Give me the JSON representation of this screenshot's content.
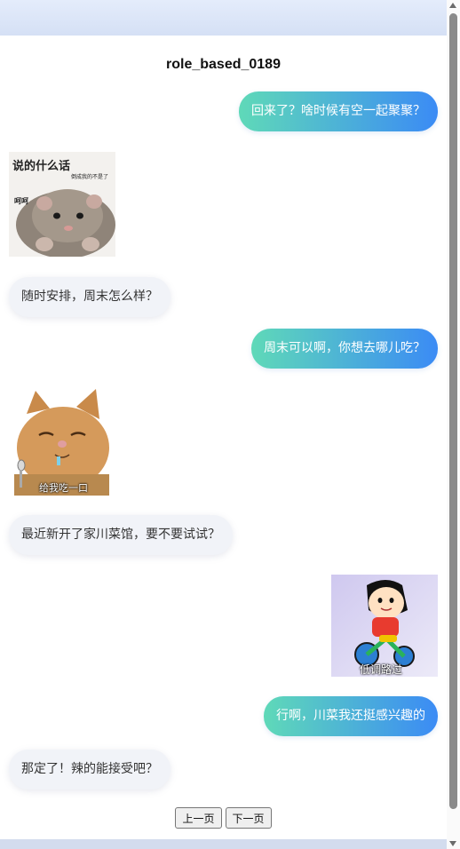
{
  "chat": {
    "title": "role_based_0189",
    "messages": [
      {
        "side": "me",
        "text": "回来了？啥时候有空一起聚聚？"
      },
      {
        "side": "other",
        "sticker": "hamster-meme",
        "caption_main": "说的什么话",
        "caption_small": "倒成我的不是了",
        "caption_side": "呵呵"
      },
      {
        "side": "other",
        "text": "随时安排，周末怎么样？"
      },
      {
        "side": "me",
        "text": "周末可以啊，你想去哪儿吃？"
      },
      {
        "side": "other",
        "sticker": "cat-meme",
        "caption": "给我吃一口"
      },
      {
        "side": "other",
        "text": "最近新开了家川菜馆，要不要试试？"
      },
      {
        "side": "me",
        "sticker": "shinchan-meme",
        "caption": "低调路过"
      },
      {
        "side": "me",
        "text": "行啊，川菜我还挺感兴趣的"
      },
      {
        "side": "other",
        "text": "那定了！辣的能接受吧？"
      }
    ]
  },
  "pager": {
    "prev_label": "上一页",
    "next_label": "下一页"
  },
  "colors": {
    "bubble_me_start": "#5fd9b8",
    "bubble_me_end": "#3b8bf5",
    "bubble_other": "#f1f3f8"
  }
}
